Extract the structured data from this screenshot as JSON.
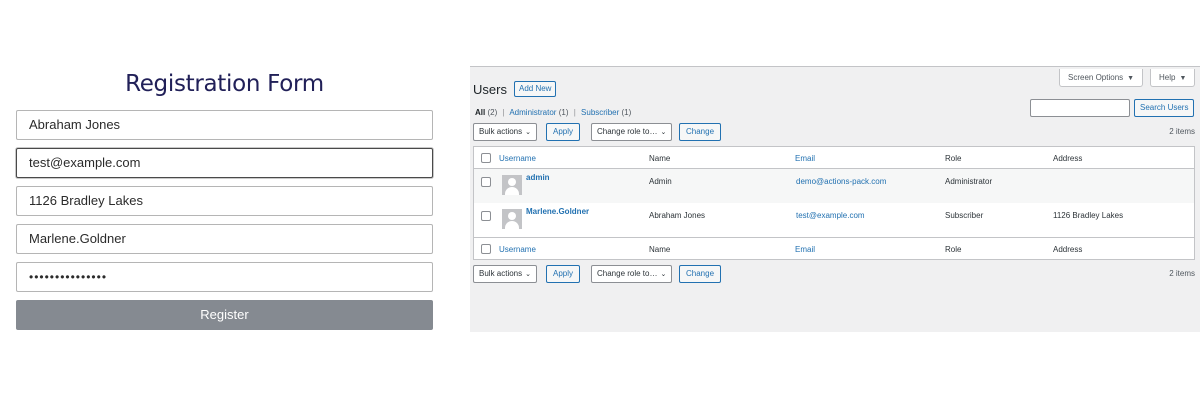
{
  "registration": {
    "title": "Registration Form",
    "fields": {
      "name": "Abraham Jones",
      "email": "test@example.com",
      "address": "1126 Bradley Lakes",
      "username": "Marlene.Goldner",
      "password_mask": "•••••••••••••••"
    },
    "submit_label": "Register"
  },
  "wp": {
    "screen_options": "Screen Options",
    "help": "Help",
    "title": "Users",
    "add_new": "Add New",
    "filters": {
      "all": "All",
      "all_count": "(2)",
      "administrator": "Administrator",
      "administrator_count": "(1)",
      "subscriber": "Subscriber",
      "subscriber_count": "(1)",
      "separator": "|"
    },
    "search_button": "Search Users",
    "bulk_actions": "Bulk actions",
    "apply": "Apply",
    "change_role": "Change role to…",
    "change": "Change",
    "items_count": "2 items",
    "columns": [
      "Username",
      "Name",
      "Email",
      "Role",
      "Address"
    ],
    "users": [
      {
        "username": "admin",
        "name": "Admin",
        "email": "demo@actions-pack.com",
        "role": "Administrator",
        "address": ""
      },
      {
        "username": "Marlene.Goldner",
        "name": "Abraham Jones",
        "email": "test@example.com",
        "role": "Subscriber",
        "address": "1126 Bradley Lakes"
      }
    ]
  },
  "colors": {
    "form_title": "#212058",
    "register_button": "#858a91",
    "wp_link": "#2271b1",
    "wp_background": "#f0f0f1"
  },
  "icons": {
    "dropdown": "chevron-down-icon",
    "avatar": "default-avatar-icon"
  }
}
